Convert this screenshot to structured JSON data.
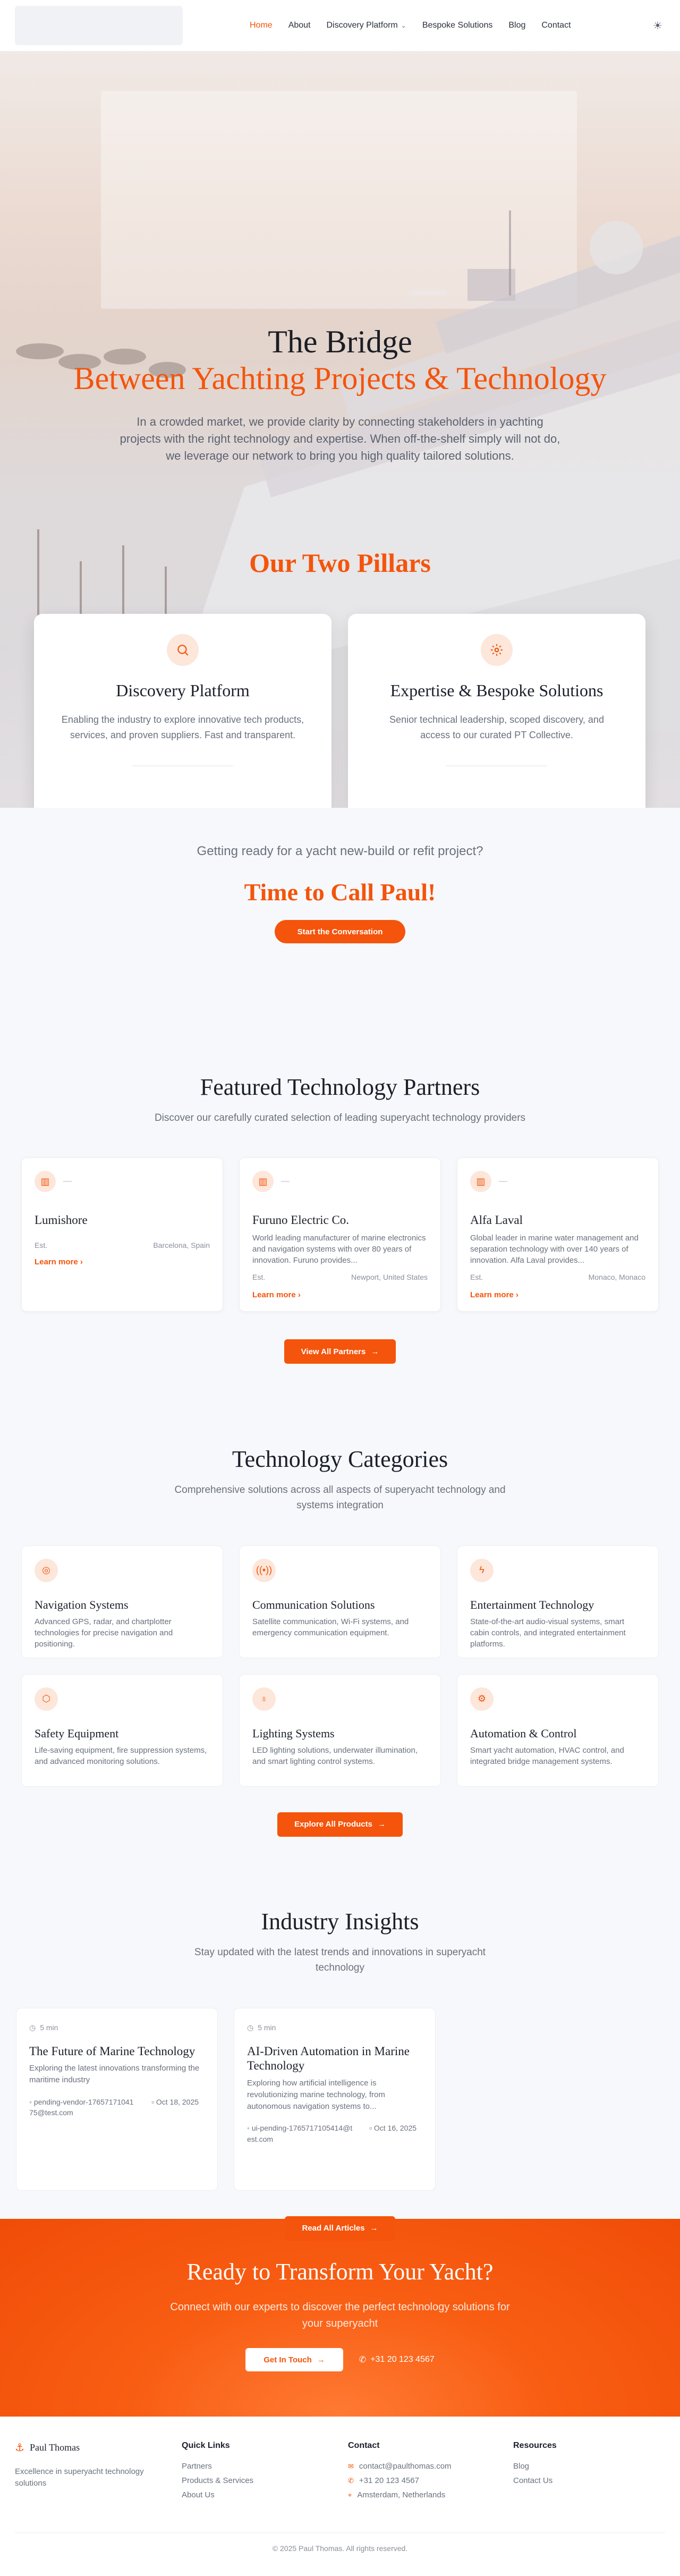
{
  "nav": {
    "links": [
      "Home",
      "About",
      "Discovery Platform",
      "Bespoke Solutions",
      "Blog",
      "Contact"
    ],
    "theme_icon": "sun-icon"
  },
  "hero": {
    "title_line1": "The Bridge",
    "title_line2": "Between Yachting Projects & Technology",
    "subtitle": "In a crowded market, we provide clarity by connecting stakeholders in yachting projects with the right technology and expertise. When off-the-shelf simply will not do, we leverage our network to bring you high quality tailored solutions."
  },
  "pillars": {
    "heading": "Our Two Pillars",
    "items": [
      {
        "icon": "search-icon",
        "title": "Discovery Platform",
        "desc": "Enabling the industry to explore innovative tech products, services, and proven suppliers. Fast and transparent."
      },
      {
        "icon": "gear-icon",
        "title": "Expertise & Bespoke Solutions",
        "desc": "Senior technical leadership, scoped discovery, and access to our curated PT Collective."
      }
    ]
  },
  "paul": {
    "question": "Getting ready for a yacht new-build or refit project?",
    "heading": "Time to Call Paul!",
    "button": "Start the Conversation"
  },
  "partners": {
    "heading": "Featured Technology Partners",
    "subtitle": "Discover our carefully curated selection of leading superyacht technology providers",
    "items": [
      {
        "name": "Lumishore",
        "desc": "",
        "est": "Est.",
        "location": "Barcelona, Spain",
        "more": "Learn more"
      },
      {
        "name": "Furuno Electric Co.",
        "desc": "World leading manufacturer of marine electronics and navigation systems with over 80 years of innovation. Furuno provides...",
        "est": "Est.",
        "location": "Newport, United States",
        "more": "Learn more"
      },
      {
        "name": "Alfa Laval",
        "desc": "Global leader in marine water management and separation technology with over 140 years of innovation. Alfa Laval provides...",
        "est": "Est.",
        "location": "Monaco, Monaco",
        "more": "Learn more"
      }
    ],
    "button": "View All Partners"
  },
  "categories": {
    "heading": "Technology Categories",
    "subtitle": "Comprehensive solutions across all aspects of superyacht technology and systems integration",
    "items": [
      {
        "icon": "compass-icon",
        "name": "Navigation Systems",
        "desc": "Advanced GPS, radar, and chartplotter technologies for precise navigation and positioning."
      },
      {
        "icon": "signal-icon",
        "name": "Communication Solutions",
        "desc": "Satellite communication, Wi-Fi systems, and emergency communication equipment."
      },
      {
        "icon": "lightning-icon",
        "name": "Entertainment Technology",
        "desc": "State-of-the-art audio-visual systems, smart cabin controls, and integrated entertainment platforms."
      },
      {
        "icon": "shield-icon",
        "name": "Safety Equipment",
        "desc": "Life-saving equipment, fire suppression systems, and advanced monitoring solutions."
      },
      {
        "icon": "bulb-icon",
        "name": "Lighting Systems",
        "desc": "LED lighting solutions, underwater illumination, and smart lighting control systems."
      },
      {
        "icon": "gear-icon",
        "name": "Automation & Control",
        "desc": "Smart yacht automation, HVAC control, and integrated bridge management systems."
      }
    ],
    "button": "Explore All Products"
  },
  "insights": {
    "heading": "Industry Insights",
    "subtitle": "Stay updated with the latest trends and innovations in superyacht technology",
    "items": [
      {
        "time": "5 min",
        "title": "The Future of Marine Technology",
        "desc": "Exploring the latest innovations transforming the maritime industry",
        "author": "pending-vendor-1765717104175@test.com",
        "date": "Oct 18, 2025"
      },
      {
        "time": "5 min",
        "title": "AI-Driven Automation in Marine Technology",
        "desc": "Exploring how artificial intelligence is revolutionizing marine technology, from autonomous navigation systems to...",
        "author": "ui-pending-1765717105414@test.com",
        "date": "Oct 16, 2025"
      }
    ],
    "button": "Read All Articles"
  },
  "cta": {
    "heading": "Ready to Transform Your Yacht?",
    "text": "Connect with our experts to discover the perfect technology solutions for your superyacht",
    "button": "Get In Touch",
    "phone": "+31 20 123 4567"
  },
  "footer": {
    "brand": "Paul Thomas",
    "tagline": "Excellence in superyacht technology solutions",
    "quick_links_title": "Quick Links",
    "quick_links": [
      "Partners",
      "Products & Services",
      "About Us"
    ],
    "contact_title": "Contact",
    "contact": [
      "contact@paulthomas.com",
      "+31 20 123 4567",
      "Amsterdam, Netherlands"
    ],
    "resources_title": "Resources",
    "resources": [
      "Blog",
      "Contact Us"
    ],
    "copyright": "© 2025 Paul Thomas. All rights reserved."
  },
  "colors": {
    "accent": "#f4540c",
    "background": "#f7f8fb",
    "text": "#1b1f2a"
  }
}
